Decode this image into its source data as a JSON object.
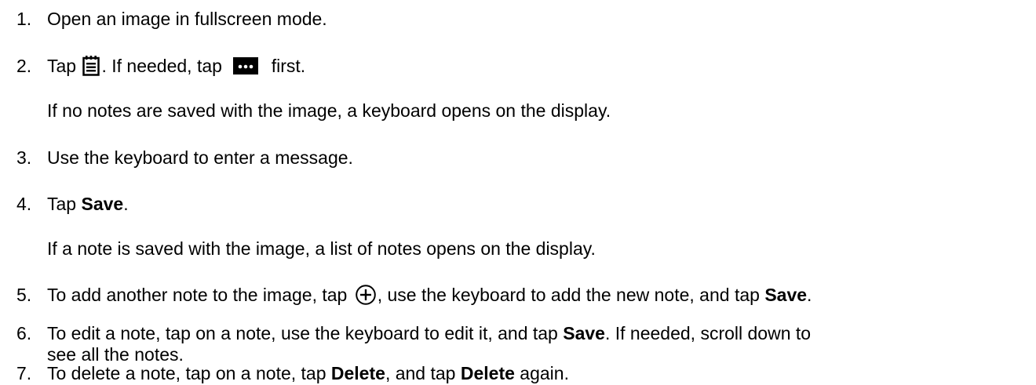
{
  "steps": [
    {
      "num": "1.",
      "parts": [
        "Open an image in fullscreen mode."
      ]
    },
    {
      "num": "2.",
      "parts": [
        "Tap ",
        ". If needed, tap ",
        " first."
      ],
      "cont": "If no notes are saved with the image, a keyboard opens on the display.",
      "icons": [
        "notes-icon",
        "more-options-icon"
      ]
    },
    {
      "num": "3.",
      "parts": [
        "Use the keyboard to enter a message."
      ]
    },
    {
      "num": "4.",
      "parts": [
        "Tap ",
        "Save",
        "."
      ],
      "cont": "If a note is saved with the image, a list of notes opens on the display."
    },
    {
      "num": "5.",
      "parts": [
        "To add another note to the image, tap ",
        ", use the keyboard to add the new note, and tap ",
        "Save",
        "."
      ],
      "icons": [
        "add-note-icon"
      ]
    },
    {
      "num": "6.",
      "parts": [
        "To edit a note, tap on a note, use the keyboard to edit it, and tap ",
        "Save",
        ". If needed, scroll down to"
      ],
      "cont": "see all the notes."
    },
    {
      "num": "7.",
      "parts": [
        "To delete a note, tap on a note, tap ",
        "Delete",
        ", and tap ",
        "Delete",
        " again."
      ]
    }
  ]
}
